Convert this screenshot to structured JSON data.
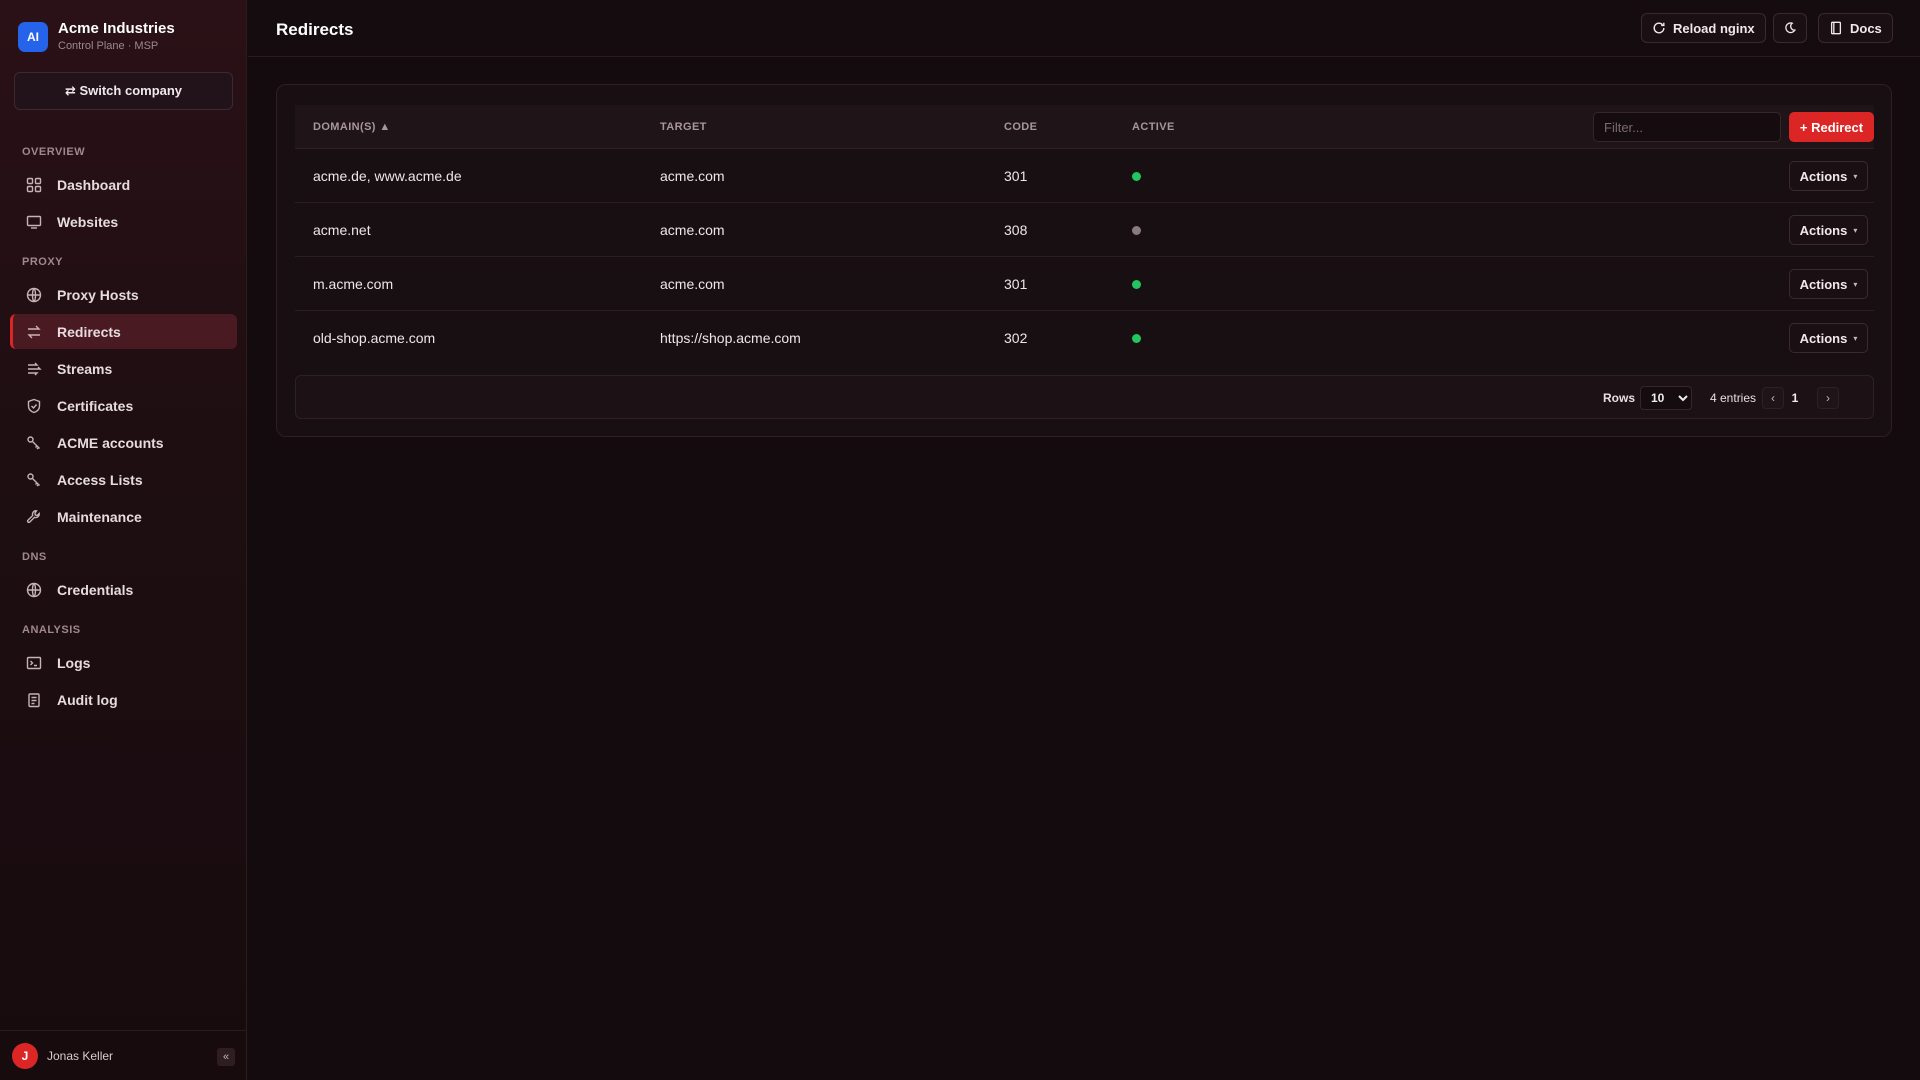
{
  "sidebar": {
    "brand_initials": "AI",
    "company": "Acme Industries",
    "subtitle": "Control Plane · MSP",
    "switch_label": "⇄ Switch company",
    "sections": {
      "overview": "OVERVIEW",
      "proxy": "PROXY",
      "dns": "DNS",
      "analysis": "ANALYSIS"
    },
    "items": [
      {
        "label": "Dashboard",
        "icon": "dashboard-icon"
      },
      {
        "label": "Websites",
        "icon": "monitor-icon"
      },
      {
        "label": "Proxy Hosts",
        "icon": "globe-icon"
      },
      {
        "label": "Redirects",
        "icon": "redirect-icon",
        "active": true
      },
      {
        "label": "Streams",
        "icon": "streams-icon"
      },
      {
        "label": "Certificates",
        "icon": "shield-icon"
      },
      {
        "label": "ACME accounts",
        "icon": "key-icon"
      },
      {
        "label": "Access Lists",
        "icon": "key-icon"
      },
      {
        "label": "Maintenance",
        "icon": "wrench-icon"
      },
      {
        "label": "Credentials",
        "icon": "globe-icon"
      },
      {
        "label": "Logs",
        "icon": "terminal-icon"
      },
      {
        "label": "Audit log",
        "icon": "clipboard-icon"
      }
    ],
    "user_initial": "J",
    "user_name": "Jonas Keller",
    "collapse_label": "«"
  },
  "header": {
    "title": "Redirects",
    "reload_label": "Reload nginx",
    "theme_icon": "moon-icon",
    "docs_label": "Docs"
  },
  "table": {
    "columns": [
      "DOMAIN(S) ▲",
      "TARGET",
      "CODE",
      "ACTIVE"
    ],
    "filter_placeholder": "Filter...",
    "add_label": "+ Redirect",
    "actions_label": "Actions",
    "rows": [
      {
        "domains": "acme.de, www.acme.de",
        "target": "acme.com",
        "code": "301",
        "active": true
      },
      {
        "domains": "acme.net",
        "target": "acme.com",
        "code": "308",
        "active": false
      },
      {
        "domains": "m.acme.com",
        "target": "acme.com",
        "code": "301",
        "active": true
      },
      {
        "domains": "old-shop.acme.com",
        "target": "https://shop.acme.com",
        "code": "302",
        "active": true
      }
    ]
  },
  "pager": {
    "rows_label": "Rows",
    "rows_value": "10",
    "entries": "4 entries",
    "page": "1",
    "prev": "‹",
    "next": "›"
  },
  "colors": {
    "accent": "#dc2626",
    "active_dot": "#22c55e",
    "inactive_dot": "#8a7a7e",
    "brand": "#2563eb"
  }
}
